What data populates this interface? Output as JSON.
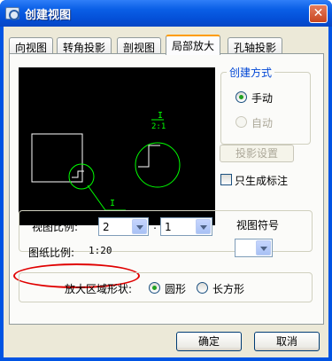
{
  "window": {
    "title": "创建视图",
    "close_glyph": "✕"
  },
  "tabs": [
    {
      "label": "向视图"
    },
    {
      "label": "转角投影"
    },
    {
      "label": "剖视图"
    },
    {
      "label": "局部放大"
    },
    {
      "label": "孔轴投影"
    }
  ],
  "preview": {
    "label_top": "I",
    "label_scale": "2:1",
    "label_bottom": "I"
  },
  "creation_method": {
    "title": "创建方式",
    "options": [
      {
        "label": "手动",
        "checked": true,
        "enabled": true
      },
      {
        "label": "自动",
        "checked": false,
        "enabled": false
      }
    ]
  },
  "projection_settings_label": "投影设置",
  "only_annotation_label": "只生成标注",
  "view_ratio": {
    "label": "视图比例:",
    "numerator": "2",
    "colon": ":",
    "denominator": "1"
  },
  "view_symbol_label": "视图符号",
  "paper_ratio": {
    "label": "图纸比例:",
    "value": "1:20"
  },
  "zoom_shape": {
    "label": "放大区域形状:",
    "options": [
      {
        "label": "圆形",
        "checked": true
      },
      {
        "label": "长方形",
        "checked": false
      }
    ]
  },
  "buttons": {
    "ok": "确定",
    "cancel": "取消"
  },
  "colors": {
    "preview_bg": "#000000",
    "preview_green": "#00ff00",
    "preview_white": "#ffffff",
    "highlight_red": "#e00000"
  }
}
